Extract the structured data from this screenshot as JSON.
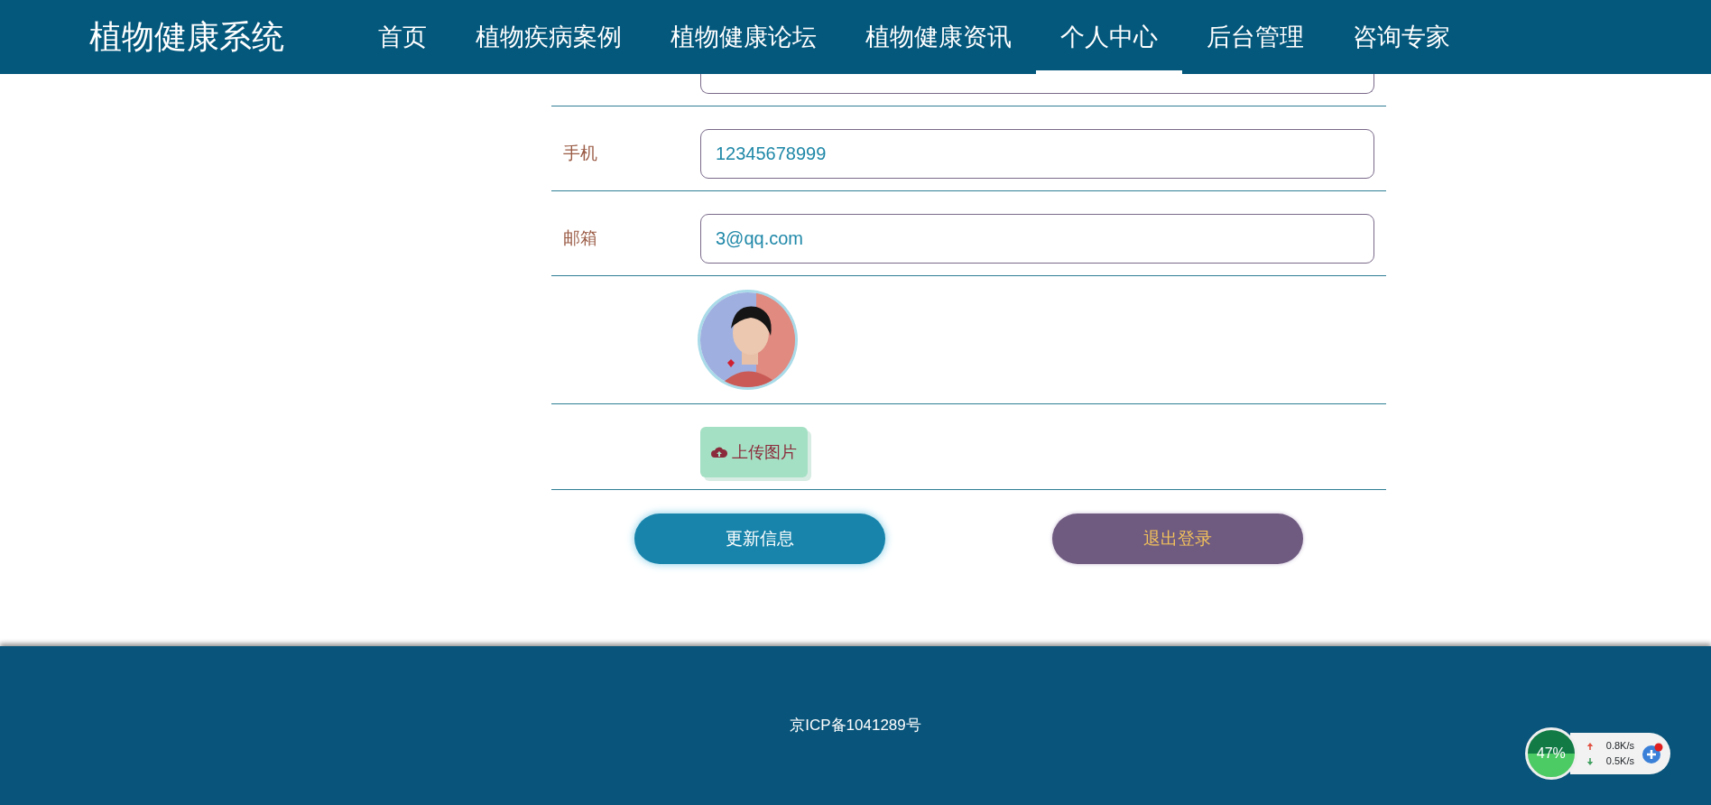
{
  "brand": "植物健康系统",
  "nav": [
    {
      "label": "首页",
      "selected": false
    },
    {
      "label": "植物疾病案例",
      "selected": false
    },
    {
      "label": "植物健康论坛",
      "selected": false
    },
    {
      "label": "植物健康资讯",
      "selected": false
    },
    {
      "label": "个人中心",
      "selected": true
    },
    {
      "label": "后台管理",
      "selected": false
    },
    {
      "label": "咨询专家",
      "selected": false
    }
  ],
  "form": {
    "rows": [
      {
        "kind": "covered_field"
      },
      {
        "kind": "field",
        "label": "手机",
        "value": "12345678999"
      },
      {
        "kind": "field",
        "label": "邮箱",
        "value": "3@qq.com"
      },
      {
        "kind": "avatar"
      },
      {
        "kind": "upload",
        "button": "上传图片"
      }
    ]
  },
  "buttons": [
    {
      "label": "更新信息",
      "kind": "primary"
    },
    {
      "label": "退出登录",
      "kind": "secondary"
    }
  ],
  "footer": {
    "icp": "京ICP备1041289号"
  },
  "speed_widget": {
    "percent": "47%",
    "upload": "0.8K/s",
    "download": "0.5K/s"
  }
}
